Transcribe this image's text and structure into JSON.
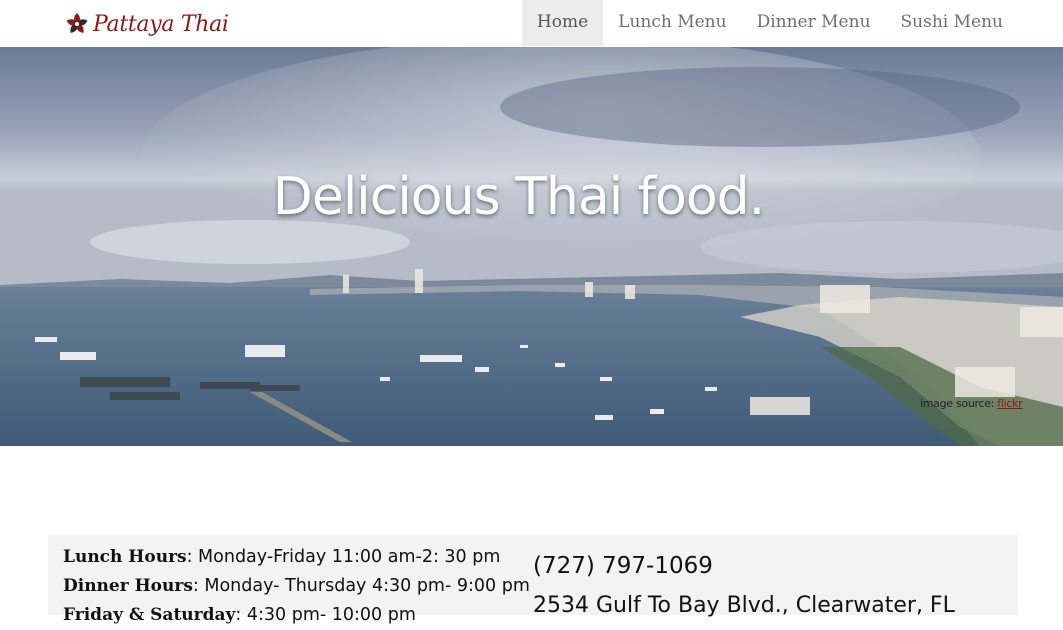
{
  "brand": {
    "name": "Pattaya Thai",
    "logo_icon": "flower-logo-icon",
    "color": "#8b1a1a"
  },
  "nav": {
    "items": [
      {
        "label": "Home",
        "active": true
      },
      {
        "label": "Lunch Menu",
        "active": false
      },
      {
        "label": "Dinner Menu",
        "active": false
      },
      {
        "label": "Sushi Menu",
        "active": false
      }
    ]
  },
  "hero": {
    "title": "Delicious Thai food.",
    "credit_prefix": "image source: ",
    "credit_link": "flickr"
  },
  "info": {
    "hours": [
      {
        "label": "Lunch Hours",
        "value": ": Monday-Friday 11:00 am-2: 30 pm"
      },
      {
        "label": "Dinner Hours",
        "value": ": Monday- Thursday 4:30 pm- 9:00 pm"
      },
      {
        "label": "Friday & Saturday",
        "value": ": 4:30 pm- 10:00 pm"
      }
    ],
    "phone": "(727) 797-1069",
    "address": "2534 Gulf To Bay Blvd., Clearwater, FL"
  }
}
